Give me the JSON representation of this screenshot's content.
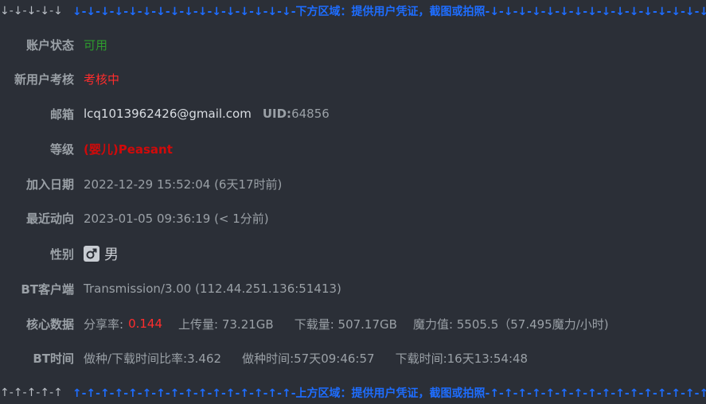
{
  "banner_top": {
    "left_arrows": "↓-↓-↓-↓-↓",
    "text": "↓-↓-↓-↓-↓-↓-↓-↓-↓-↓-↓-↓-↓-↓-↓-↓-下方区域：提供用户凭证，截图或拍照-↓-↓-↓-↓-↓-↓-↓-↓-↓-↓-↓-↓-↓-↓-↓-↓"
  },
  "account_status": {
    "label": "账户状态",
    "value": "可用"
  },
  "new_user_review": {
    "label": "新用户考核",
    "value": "考核中"
  },
  "email_row": {
    "label": "邮箱",
    "email": "lcq1013962426@gmail.com",
    "uid_label": "UID:",
    "uid_value": "64856"
  },
  "level": {
    "label": "等级",
    "value": "(婴儿)Peasant"
  },
  "join_date": {
    "label": "加入日期",
    "value": "2022-12-29 15:52:04 (6天17时前)"
  },
  "last_activity": {
    "label": "最近动向",
    "value": "2023-01-05 09:36:19 (< 1分前)"
  },
  "gender": {
    "label": "性别",
    "icon": "male-icon",
    "value": "男"
  },
  "bt_client": {
    "label": "BT客户端",
    "value": "Transmission/3.00 (112.44.251.136:51413)"
  },
  "core_data": {
    "label": "核心数据",
    "share_ratio_label": "分享率:",
    "share_ratio_value": "0.144",
    "upload": "上传量: 73.21GB",
    "download": "下载量: 507.17GB",
    "magic": "魔力值: 5505.5（57.495魔力/小时)"
  },
  "bt_time": {
    "label": "BT时间",
    "ratio": "做种/下载时间比率:3.462",
    "seed_time": "做种时间:57天09:46:57",
    "download_time": "下载时间:16天13:54:48"
  },
  "banner_bottom": {
    "left_arrows": "↑-↑-↑-↑-↑",
    "text": "↑-↑-↑-↑-↑-↑-↑-↑-↑-↑-↑-↑-↑-↑-↑-↑-上方区域：提供用户凭证，截图或拍照-↑-↑-↑-↑-↑-↑-↑-↑-↑-↑-↑-↑-↑-↑-↑-↑"
  },
  "colors": {
    "background": "#2b2f37",
    "banner_blue": "#1e6dff",
    "status_green": "#2e9b2e",
    "alert_red": "#ff2d2d",
    "rank_red": "#d10a0a"
  }
}
